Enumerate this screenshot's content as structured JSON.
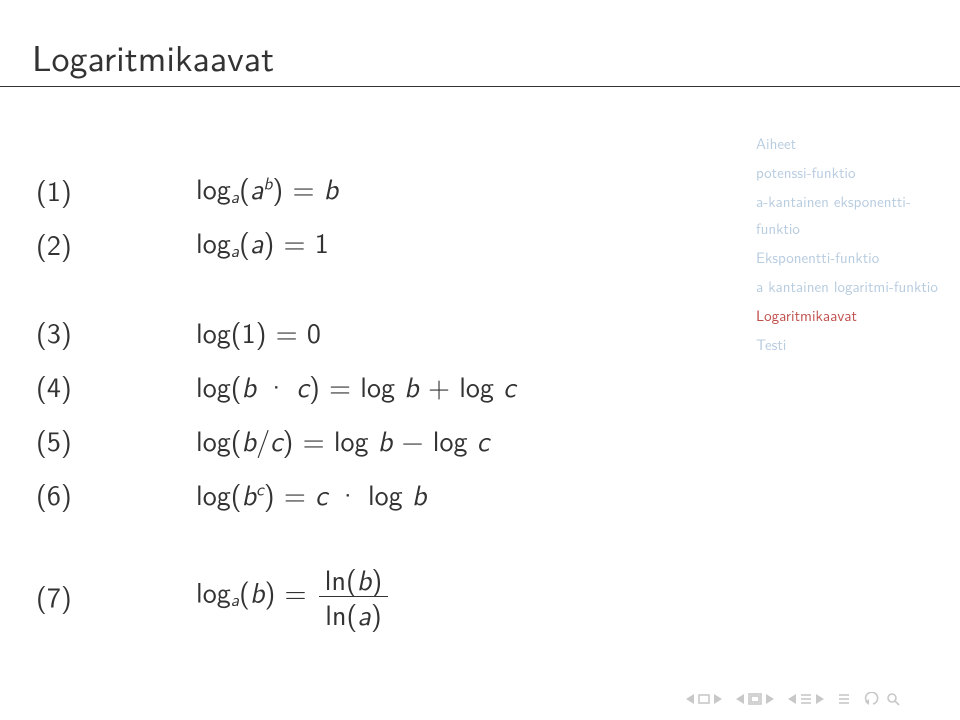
{
  "title": "Logaritmikaavat",
  "sidebar": {
    "heading": "Aiheet",
    "items": [
      "potenssi-funktio",
      "a-kantainen eksponentti-funktio",
      "Eksponentti-funktio",
      "a kantainen logaritmi-funktio",
      "Logaritmikaavat",
      "Testi"
    ],
    "active_index": 4
  },
  "equationGroups": [
    {
      "rows": [
        {
          "num_html": "(1)",
          "body_html": "log<span class='sub'>a</span>(<span class='it'>a</span><span class='sup'>b</span>) = <span class='it'>b</span>"
        },
        {
          "num_html": "(2)",
          "body_html": "log<span class='sub'>a</span>(<span class='it'>a</span>) = 1"
        }
      ]
    },
    {
      "rows": [
        {
          "num_html": "(3)",
          "body_html": "log(1) = 0"
        },
        {
          "num_html": "(4)",
          "body_html": "log(<span class='it'>b</span> · <span class='it'>c</span>) = log <span class='it'>b</span> + log <span class='it'>c</span>"
        },
        {
          "num_html": "(5)",
          "body_html": "log(<span class='it'>b</span>/<span class='it'>c</span>) = log <span class='it'>b</span> − log <span class='it'>c</span>"
        },
        {
          "num_html": "(6)",
          "body_html": "log(<span class='it'>b</span><span class='sup'>c</span>) = <span class='it'>c</span> · log <span class='it'>b</span>"
        }
      ]
    },
    {
      "rows": [
        {
          "num_html": "(7)",
          "body_html": "log<span class='sub'>a</span>(<span class='it'>b</span>) = <span class='frac'><span class='num'>ln(<span class=\"it\">b</span>)</span><span class='den'>ln(<span class=\"it\">a</span>)</span></span>"
        }
      ]
    }
  ],
  "nav": {
    "first_icon": "nav-first-icon",
    "prev_icon": "nav-prev-icon",
    "nav_prev_slide_icon": "nav-prev-slide-icon",
    "nav_next_slide_icon": "nav-next-slide-icon",
    "nav_prev_section_icon": "nav-prev-section-icon",
    "nav_next_section_icon": "nav-next-section-icon",
    "nav_prev_sub_icon": "nav-prev-sub-icon",
    "nav_next_sub_icon": "nav-next-sub-icon",
    "undo_icon": "nav-undo-icon",
    "search_icon": "nav-search-icon"
  }
}
